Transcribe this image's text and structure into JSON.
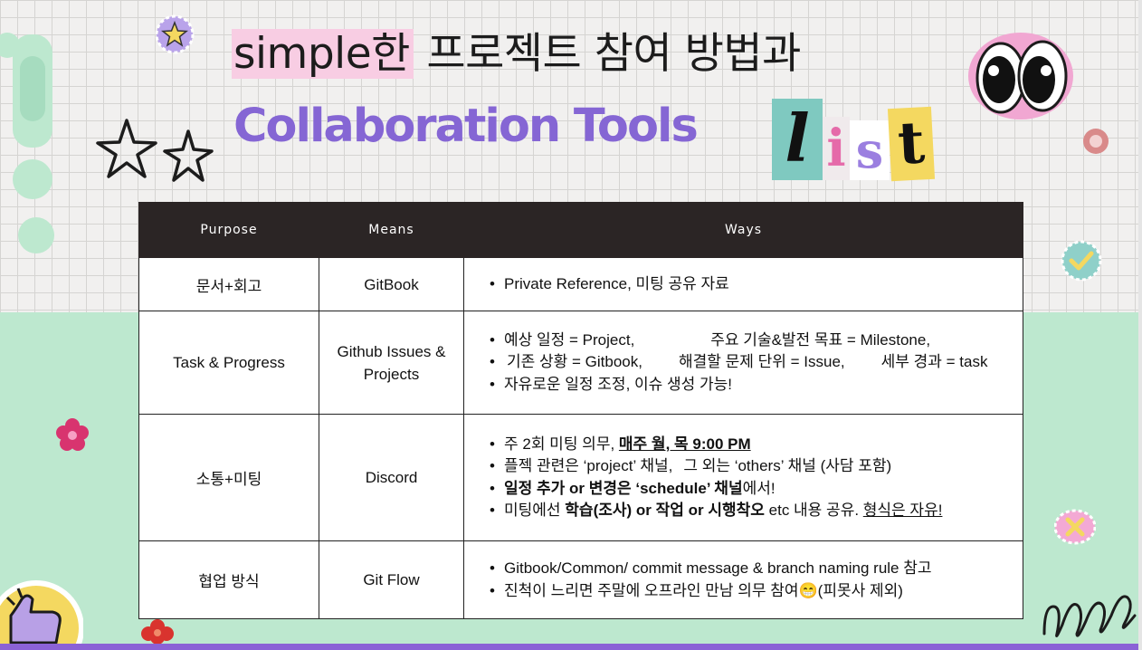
{
  "title": {
    "line1_highlight": "simple한",
    "line1_rest": " 프로젝트 참여 방법과",
    "line2": "Collaboration Tools",
    "list_letters": [
      "l",
      "i",
      "s",
      "t"
    ]
  },
  "table": {
    "headers": [
      "Purpose",
      "Means",
      "Ways"
    ],
    "rows": [
      {
        "purpose": "문서+회고",
        "means": "GitBook",
        "ways": {
          "l1": "Private Reference, 미팅 공유 자료"
        }
      },
      {
        "purpose": "Task &  Progress",
        "means_line1": "Github Issues &",
        "means_line2": "Projects",
        "ways": {
          "l1a": "예상 일정 = Project,",
          "l1b": "주요 기술&발전 목표 = Milestone,",
          "l2a": "기존 상황 = Gitbook,",
          "l2b": "해결할 문제 단위 = Issue,",
          "l2c": "세부 경과 = task",
          "l3": "자유로운 일정 조정, 이슈 생성 가능!"
        }
      },
      {
        "purpose": "소통+미팅",
        "means": "Discord",
        "ways": {
          "l1a": "주 2회 미팅 의무, ",
          "l1b": "매주 월, 목 9:00 PM",
          "l2a": "플젝 관련은 ‘project’ 채널,",
          "l2b": "그 외는  ‘others’ 채널 (사담 포함)",
          "l3a": "일정 추가 or 변경은 ‘schedule’ 채널",
          "l3b": "에서!",
          "l4a": "미팅에선 ",
          "l4b": "학습(조사) or 작업 or 시행착오",
          "l4c": " etc 내용 공유. ",
          "l4d": "형식은 자유!"
        }
      },
      {
        "purpose": "협업 방식",
        "means": "Git Flow",
        "ways": {
          "l1": "Gitbook/Common/ commit message & branch  naming rule 참고",
          "l2a": "진척이 느리면 주말에 오프라인 만남 의무 참여",
          "l2emoji": "😁",
          "l2b": "(피못사 제외)"
        }
      }
    ]
  },
  "colors": {
    "purple": "#8566d4",
    "mint": "#bde8cf",
    "header_bg": "#2b2525",
    "pink": "#f8cde3",
    "yellow": "#f4d860"
  },
  "icons": [
    "star-sticker-icon",
    "doodle-star-icon",
    "googly-eyes-icon",
    "sequin-icon",
    "check-sticker-icon",
    "flower-gem-icon",
    "x-sticker-icon",
    "thumbs-up-icon",
    "squiggle-doodle-icon"
  ]
}
